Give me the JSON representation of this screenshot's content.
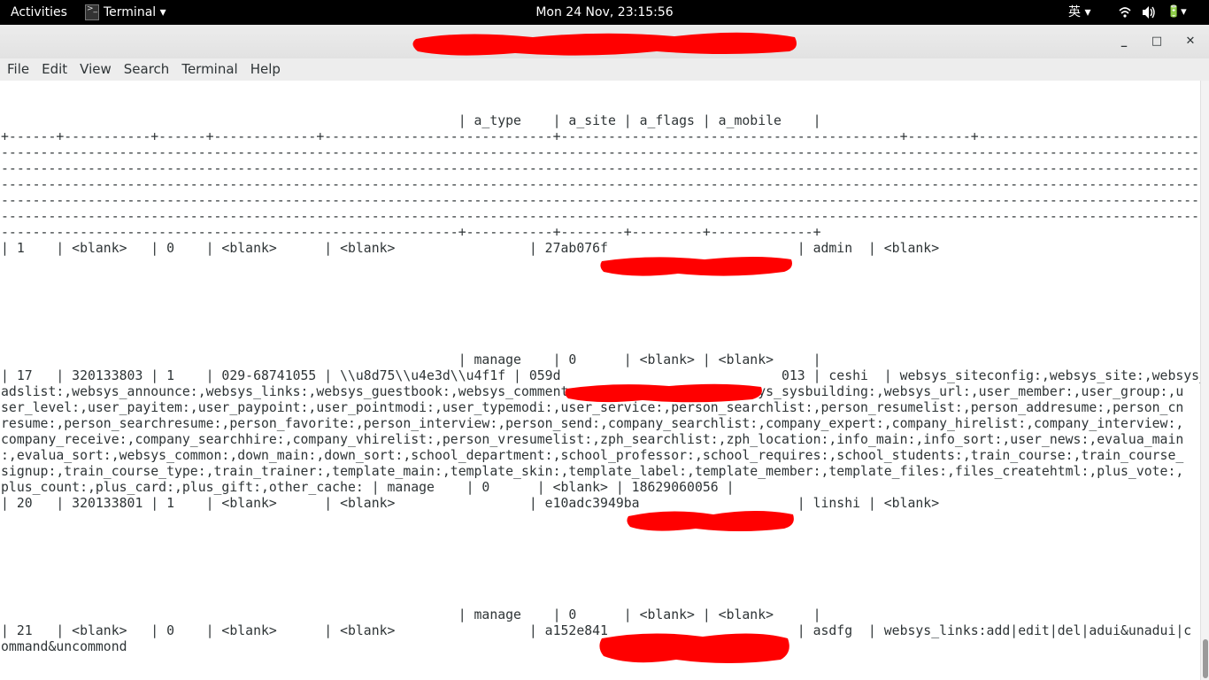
{
  "topbar": {
    "activities": "Activities",
    "app_menu": "Terminal ▾",
    "clock": "Mon 24 Nov, 23:15:56",
    "ime": "英 ▾",
    "wifi_icon": "wifi-icon",
    "volume_icon": "volume-icon",
    "system_menu": "🔋▾"
  },
  "window": {
    "minimize": "_",
    "maximize": "□",
    "close": "✕"
  },
  "menubar": {
    "items": [
      "File",
      "Edit",
      "View",
      "Search",
      "Terminal",
      "Help"
    ]
  },
  "terminal": {
    "lines": [
      "                                                          | a_type    | a_site | a_flags | a_mobile    |",
      "+------+-----------+------+-------------+-----------------------------+-------------------------------------------+--------+------------------------------------------------------",
      "------------------------------------------------------------------------------------------------------------------------------------------------------------------------------------",
      "------------------------------------------------------------------------------------------------------------------------------------------------------------------------------------",
      "------------------------------------------------------------------------------------------------------------------------------------------------------------------------------------",
      "------------------------------------------------------------------------------------------------------------------------------------------------------------------------------------",
      "------------------------------------------------------------------------------------------------------------------------------------------------------------------------------------",
      "----------------------------------------------------------+-----------+--------+---------+-------------+",
      "| 1    | <blank>   | 0    | <blank>      | <blank>                 | 27ab076f                        | admin  | <blank>",
      "",
      "",
      "",
      "",
      "",
      "",
      "                                                          | manage    | 0      | <blank> | <blank>     |",
      "| 17   | 320133803 | 1    | 029-68741055 | \\\\u8d75\\\\u4e3d\\\\u4f1f | 059d                            013 | ceshi  | websys_siteconfig:,websys_site:,websys_",
      "adslist:,websys_announce:,websys_links:,websys_guestbook:,websys_comment:,websys_sysstreet:,websys_sysbuilding:,websys_url:,user_member:,user_group:,u",
      "ser_level:,user_payitem:,user_paypoint:,user_pointmodi:,user_typemodi:,user_service:,person_searchlist:,person_resumelist:,person_addresume:,person_cn",
      "resume:,person_searchresume:,person_favorite:,person_interview:,person_send:,company_searchlist:,company_expert:,company_hirelist:,company_interview:,",
      "company_receive:,company_searchhire:,company_vhirelist:,person_vresumelist:,zph_searchlist:,zph_location:,info_main:,info_sort:,user_news:,evalua_main",
      ":,evalua_sort:,websys_common:,down_main:,down_sort:,school_department:,school_professor:,school_requires:,school_students:,train_course:,train_course_",
      "signup:,train_course_type:,train_trainer:,template_main:,template_skin:,template_label:,template_member:,template_files:,files_createhtml:,plus_vote:,",
      "plus_count:,plus_card:,plus_gift:,other_cache: | manage    | 0      | <blank> | 18629060056 |",
      "| 20   | 320133801 | 1    | <blank>      | <blank>                 | e10adc3949ba                    | linshi | <blank>",
      "",
      "",
      "",
      "",
      "",
      "",
      "                                                          | manage    | 0      | <blank> | <blank>     |",
      "| 21   | <blank>   | 0    | <blank>      | <blank>                 | a152e841                        | asdfg  | websys_links:add|edit|del|adui&unadui|c",
      "ommand&uncommond"
    ]
  },
  "colors": {
    "redaction": "#ff0000",
    "topbar_bg": "#000000",
    "terminal_fg": "#2e3436",
    "terminal_bg": "#ffffff"
  }
}
